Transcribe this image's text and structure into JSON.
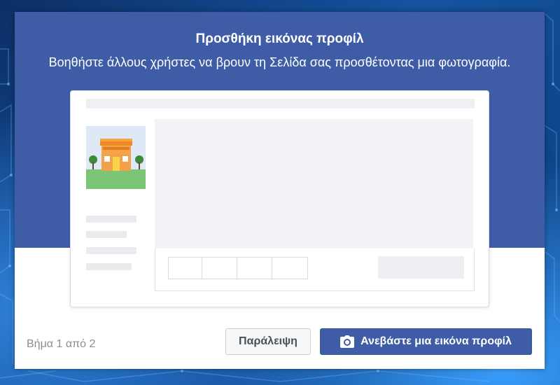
{
  "dialog": {
    "title": "Προσθήκη εικόνας προφίλ",
    "subtitle": "Βοηθήστε άλλους χρήστες να βρουν τη Σελίδα σας προσθέτοντας μια φωτογραφία."
  },
  "footer": {
    "step_text": "Βήμα 1 από 2",
    "skip_label": "Παράλειψη",
    "upload_label": "Ανεβάστε μια εικόνα προφίλ"
  },
  "icons": {
    "upload": "camera-icon",
    "preview_photo": "storefront-icon"
  },
  "colors": {
    "brand_blue": "#3e5da6",
    "button_text": "#4b4f56",
    "muted_text": "#8a8d91"
  }
}
